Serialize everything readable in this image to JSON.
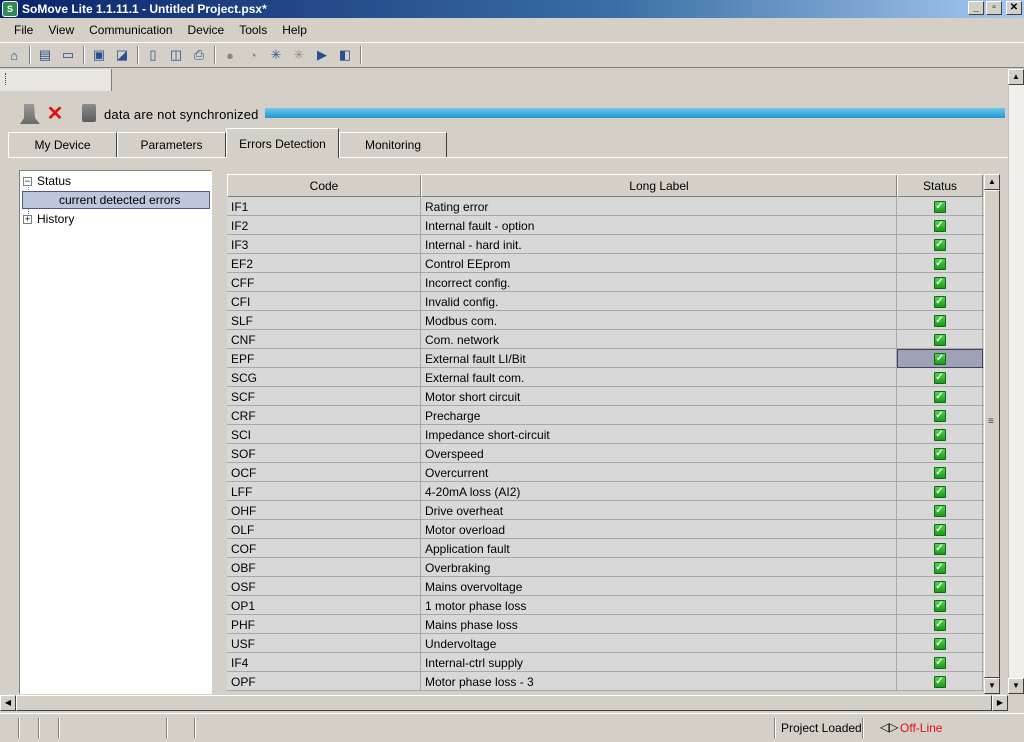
{
  "window": {
    "title": "SoMove Lite 1.1.11.1 - Untitled Project.psx*",
    "minimize": "_",
    "maximize": "▫",
    "close": "✕"
  },
  "menu": [
    "File",
    "View",
    "Communication",
    "Device",
    "Tools",
    "Help"
  ],
  "sync": {
    "text": "data are not synchronized"
  },
  "tabs": [
    "My Device",
    "Parameters",
    "Errors Detection",
    "Monitoring"
  ],
  "tree": {
    "status": "Status",
    "current": "current detected errors",
    "history": "History",
    "minus": "−",
    "plus": "+"
  },
  "table": {
    "headers": {
      "code": "Code",
      "label": "Long Label",
      "status": "Status"
    },
    "rows": [
      {
        "code": "IF1",
        "label": "Rating error"
      },
      {
        "code": "IF2",
        "label": "Internal fault - option"
      },
      {
        "code": "IF3",
        "label": "Internal - hard init."
      },
      {
        "code": "EF2",
        "label": "Control EEprom"
      },
      {
        "code": "CFF",
        "label": "Incorrect config."
      },
      {
        "code": "CFI",
        "label": "Invalid config."
      },
      {
        "code": "SLF",
        "label": "Modbus com."
      },
      {
        "code": "CNF",
        "label": "Com. network"
      },
      {
        "code": "EPF",
        "label": "External fault LI/Bit"
      },
      {
        "code": "SCG",
        "label": "External fault com."
      },
      {
        "code": "SCF",
        "label": "Motor short circuit"
      },
      {
        "code": "CRF",
        "label": "Precharge"
      },
      {
        "code": "SCI",
        "label": "Impedance short-circuit"
      },
      {
        "code": "SOF",
        "label": "Overspeed"
      },
      {
        "code": "OCF",
        "label": "Overcurrent"
      },
      {
        "code": "LFF",
        "label": "4-20mA loss (AI2)"
      },
      {
        "code": "OHF",
        "label": "Drive overheat"
      },
      {
        "code": "OLF",
        "label": "Motor overload"
      },
      {
        "code": "COF",
        "label": "Application fault"
      },
      {
        "code": "OBF",
        "label": "Overbraking"
      },
      {
        "code": "OSF",
        "label": "Mains overvoltage"
      },
      {
        "code": "OP1",
        "label": "1 motor phase loss"
      },
      {
        "code": "PHF",
        "label": "Mains phase loss"
      },
      {
        "code": "USF",
        "label": "Undervoltage"
      },
      {
        "code": "IF4",
        "label": "Internal-ctrl supply"
      },
      {
        "code": "OPF",
        "label": "Motor phase loss - 3"
      }
    ],
    "selected_row_index": 8
  },
  "statusbar": {
    "project": "Project Loaded",
    "connection": "Off-Line"
  },
  "colors": {
    "ok_green": "#2db52d",
    "offline_red": "#e01010",
    "progress_blue": "#1e9ad0"
  }
}
